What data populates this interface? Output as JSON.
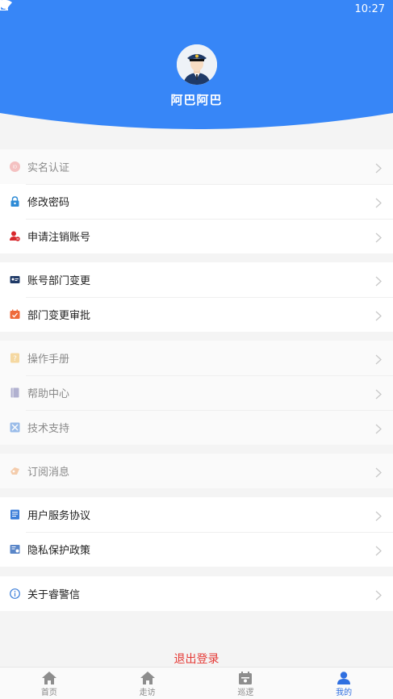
{
  "colors": {
    "brand": "#3786f7",
    "logout": "#e53935",
    "active_tab": "#2f6fe0"
  },
  "status_bar": {
    "time": "10:27"
  },
  "profile": {
    "name": "阿巴阿巴"
  },
  "menu_groups": [
    {
      "items": [
        {
          "label": "实名认证",
          "icon": "id-verify-icon",
          "disabled": true
        },
        {
          "label": "修改密码",
          "icon": "lock-icon"
        },
        {
          "label": "申请注销账号",
          "icon": "user-remove-icon"
        }
      ]
    },
    {
      "items": [
        {
          "label": "账号部门变更",
          "icon": "id-card-icon"
        },
        {
          "label": "部门变更审批",
          "icon": "approval-icon"
        }
      ]
    },
    {
      "items": [
        {
          "label": "操作手册",
          "icon": "manual-icon",
          "disabled": true
        },
        {
          "label": "帮助中心",
          "icon": "book-icon",
          "disabled": true
        },
        {
          "label": "技术支持",
          "icon": "tools-icon",
          "disabled": true
        }
      ]
    },
    {
      "items": [
        {
          "label": "订阅消息",
          "icon": "subscribe-icon",
          "disabled": true
        }
      ]
    },
    {
      "items": [
        {
          "label": "用户服务协议",
          "icon": "agreement-icon"
        },
        {
          "label": "隐私保护政策",
          "icon": "privacy-icon"
        }
      ]
    },
    {
      "items": [
        {
          "label": "关于睿警信",
          "icon": "info-icon"
        }
      ]
    }
  ],
  "logout_label": "退出登录",
  "tabbar": [
    {
      "label": "首页",
      "icon": "home-icon"
    },
    {
      "label": "走访",
      "icon": "visit-icon"
    },
    {
      "label": "巡逻",
      "icon": "calendar-icon"
    },
    {
      "label": "我的",
      "icon": "person-icon",
      "active": true
    }
  ]
}
